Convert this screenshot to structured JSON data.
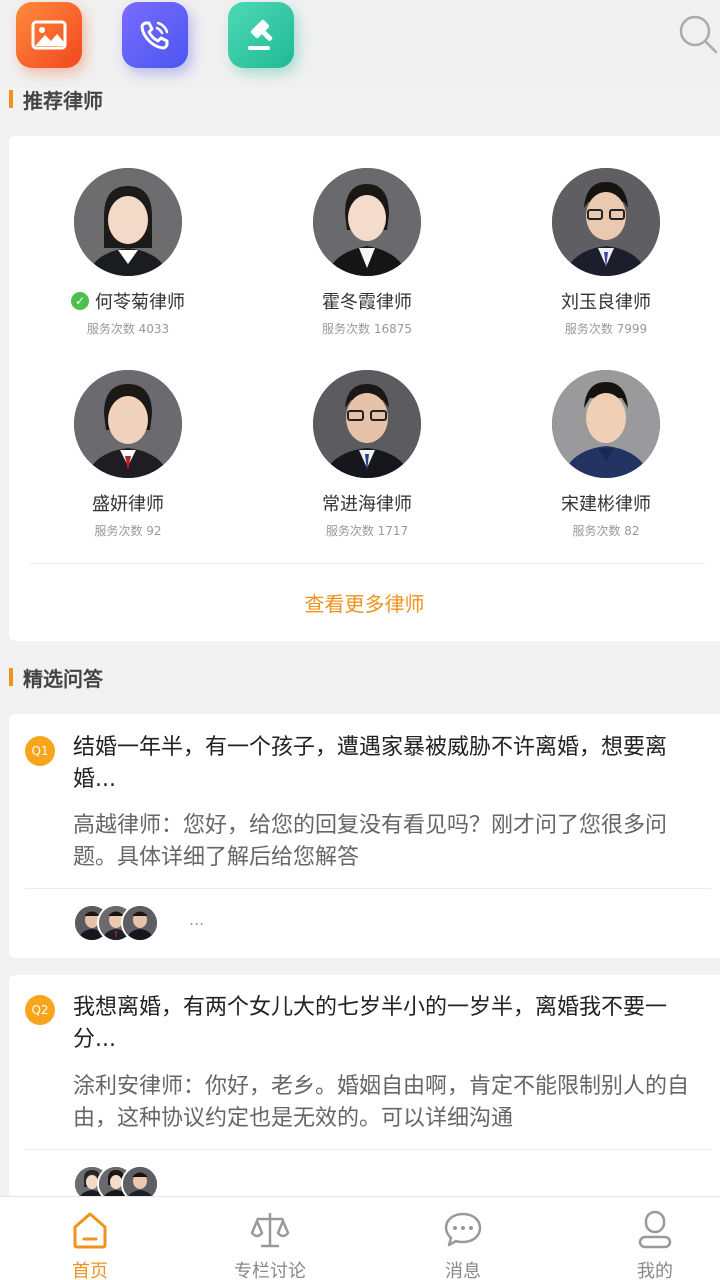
{
  "top_icons": [
    "gallery-icon",
    "phone-icon",
    "gavel-icon"
  ],
  "recommended": {
    "title": "推荐律师",
    "lawyers": [
      {
        "name": "何苓菊律师",
        "count": "服务次数 4033",
        "verified": true
      },
      {
        "name": "霍冬霞律师",
        "count": "服务次数 16875",
        "verified": false
      },
      {
        "name": "刘玉良律师",
        "count": "服务次数 7999",
        "verified": false
      },
      {
        "name": "盛妍律师",
        "count": "服务次数 92",
        "verified": false
      },
      {
        "name": "常进海律师",
        "count": "服务次数 1717",
        "verified": false
      },
      {
        "name": "宋建彬律师",
        "count": "服务次数 82",
        "verified": false
      }
    ],
    "more_label": "查看更多律师"
  },
  "qa": {
    "title": "精选问答",
    "items": [
      {
        "badge": "Q1",
        "question": "结婚一年半，有一个孩子，遭遇家暴被威胁不许离婚，想要离婚...",
        "answer": "高越律师：您好，给您的回复没有看见吗？刚才问了您很多问题。具体详细了解后给您解答",
        "more": "..."
      },
      {
        "badge": "Q2",
        "question": "我想离婚，有两个女儿大的七岁半小的一岁半，离婚我不要一分...",
        "answer": "涂利安律师：你好，老乡。婚姻自由啊，肯定不能限制别人的自由，这种协议约定也是无效的。可以详细沟通"
      }
    ]
  },
  "nav": [
    {
      "label": "首页",
      "icon": "home-icon",
      "active": true
    },
    {
      "label": "专栏讨论",
      "icon": "scale-icon",
      "active": false
    },
    {
      "label": "消息",
      "icon": "chat-icon",
      "active": false
    },
    {
      "label": "我的",
      "icon": "user-icon",
      "active": false
    }
  ],
  "colors": {
    "accent": "#f0921c",
    "verified": "#4cbf4c",
    "badge": "#f7a51c"
  }
}
